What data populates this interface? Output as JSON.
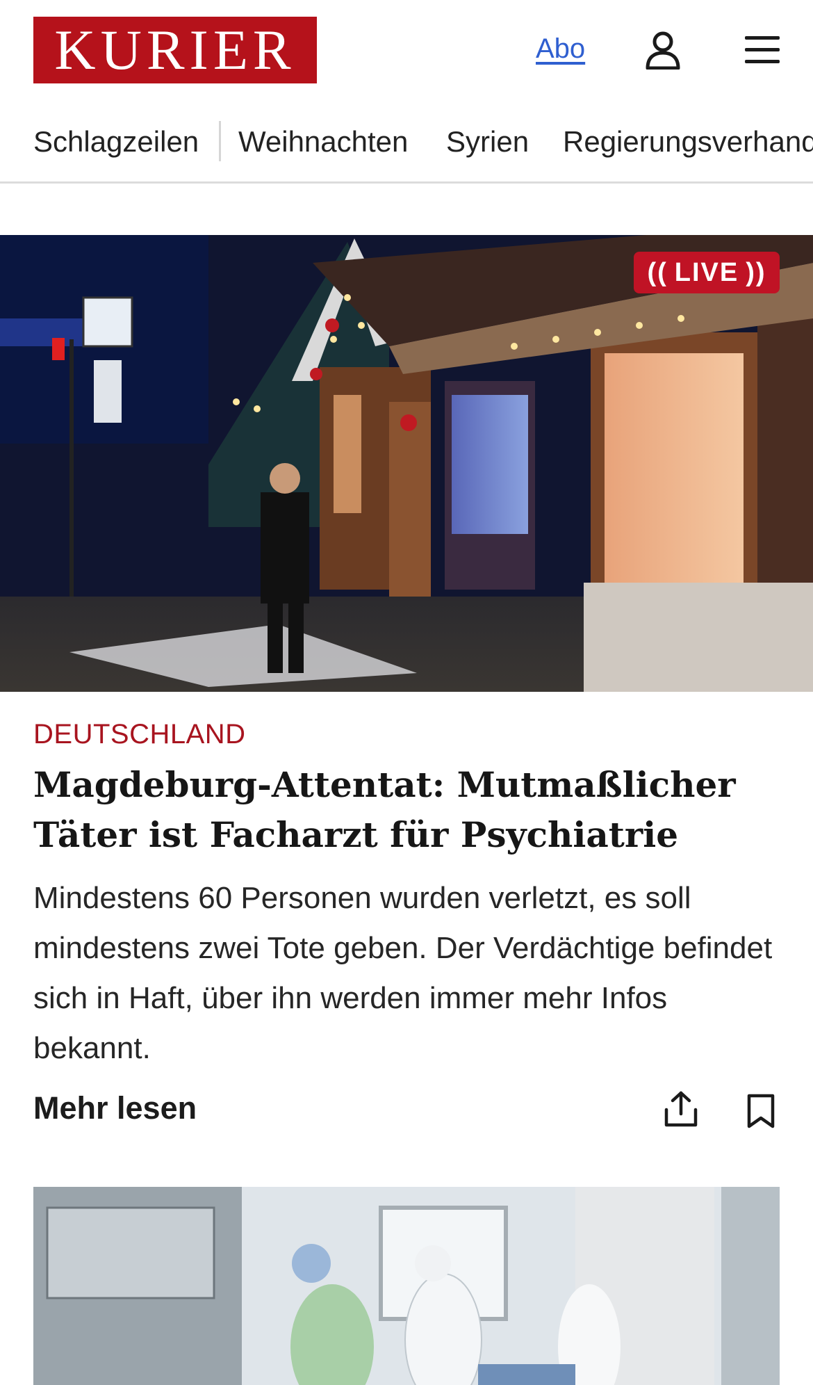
{
  "header": {
    "logo_text": "KURIER",
    "abo_label": "Abo",
    "brand_color": "#b5121b",
    "icons": [
      "user-icon",
      "hamburger-menu-icon"
    ]
  },
  "nav": {
    "items": [
      "Schlagzeilen",
      "Weihnachten",
      "Syrien",
      "Regierungsverhand"
    ]
  },
  "article": {
    "live_badge": "LIVE",
    "category": "DEUTSCHLAND",
    "headline": "Magdeburg-Attentat: Mutmaßlicher Täter ist Facharzt für Psychiatrie",
    "teaser": "Mindestens 60 Personen wurden verletzt, es soll mindestens zwei Tote geben. Der Verdächtige befindet sich in Haft, über ihn werden immer mehr Infos bekannt.",
    "more_label": "Mehr lesen",
    "actions": [
      "share-icon",
      "bookmark-icon"
    ],
    "category_color": "#a8141f",
    "live_color": "#c01325"
  }
}
